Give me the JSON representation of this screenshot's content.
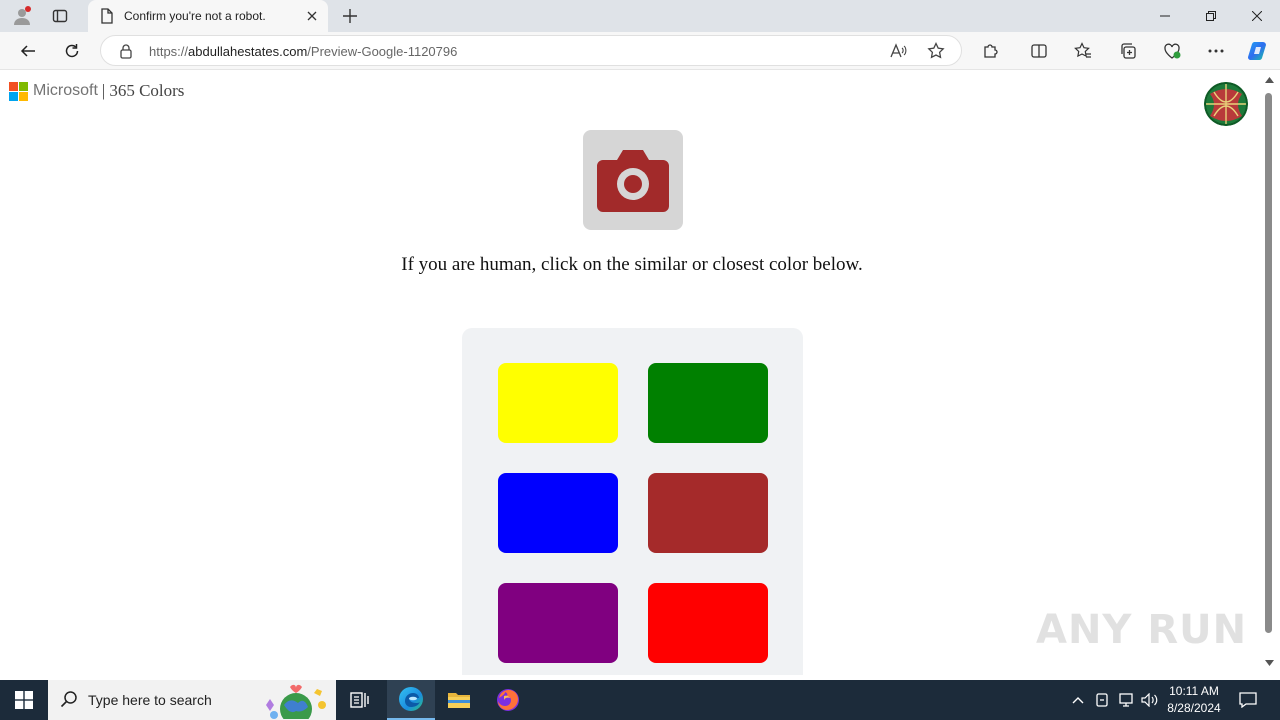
{
  "browser": {
    "tab": {
      "title": "Confirm you're not a robot."
    },
    "address": {
      "scheme": "https://",
      "host": "abdullahestates.com",
      "path": "/Preview-Google-1120796"
    }
  },
  "page": {
    "brand": {
      "company": "Microsoft",
      "separator": "|",
      "product": "365 Colors"
    },
    "instruction": "If you are human, click on the similar or closest color below.",
    "target_color": "#a22a2a",
    "swatches": [
      {
        "name": "yellow",
        "color": "#ffff00"
      },
      {
        "name": "green",
        "color": "#008000"
      },
      {
        "name": "blue",
        "color": "#0000ff"
      },
      {
        "name": "brown",
        "color": "#a52a2a"
      },
      {
        "name": "purple",
        "color": "#800080"
      },
      {
        "name": "red",
        "color": "#ff0000"
      }
    ]
  },
  "watermark": "ANY RUN",
  "taskbar": {
    "search_placeholder": "Type here to search",
    "time": "10:11 AM",
    "date": "8/28/2024"
  },
  "colors": {
    "accent": "#2b63d6",
    "taskbar": "#1c2b3a"
  }
}
